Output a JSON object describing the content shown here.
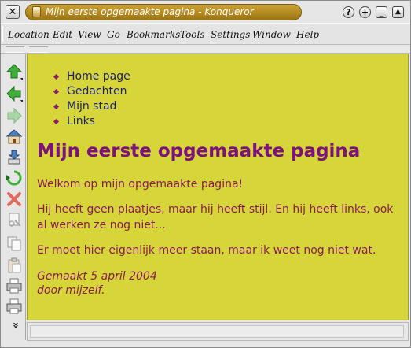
{
  "window": {
    "title": "Mijn eerste opgemaakte pagina - Konqueror",
    "close_label": "✕",
    "help_label": "?",
    "stick_label": "+",
    "minimize_label": "_",
    "maximize_label": "▲"
  },
  "menubar": {
    "items": [
      {
        "first": "L",
        "rest": "ocation"
      },
      {
        "first": "E",
        "rest": "dit"
      },
      {
        "first": "V",
        "rest": "iew"
      },
      {
        "first": "G",
        "rest": "o"
      },
      {
        "first": "B",
        "rest": "ookmarks"
      },
      {
        "first": "T",
        "rest": "ools"
      },
      {
        "first": "S",
        "rest": "ettings"
      },
      {
        "first": "W",
        "rest": "indow"
      },
      {
        "first": "H",
        "rest": "elp"
      }
    ]
  },
  "sidebar": {
    "icons": [
      "up-arrow-icon",
      "back-arrow-icon",
      "forward-arrow-icon",
      "home-icon",
      "download-icon",
      "reload-icon",
      "stop-icon",
      "cut-icon",
      "copy-icon",
      "paste-icon",
      "print-icon",
      "print-preview-icon",
      "more-chevron-icon"
    ],
    "more_label": "»"
  },
  "page": {
    "nav": [
      "Home page",
      "Gedachten",
      "Mijn stad",
      "Links"
    ],
    "heading": "Mijn eerste opgemaakte pagina",
    "p1": "Welkom op mijn opgemaakte pagina!",
    "p2": "Hij heeft geen plaatjes, maar hij heeft stijl. En hij heeft links, ook al werken ze nog niet...",
    "p3": "Er moet hier eigenlijk meer staan, maar ik weet nog niet wat.",
    "footer_line1": "Gemaakt 5 april 2004",
    "footer_line2": "door mijzelf."
  },
  "colors": {
    "page_background": "#d6d63a",
    "heading": "#7f1080",
    "text": "#8a1a56",
    "links": "#1e1e70",
    "title_pill": "#b38a1e"
  }
}
